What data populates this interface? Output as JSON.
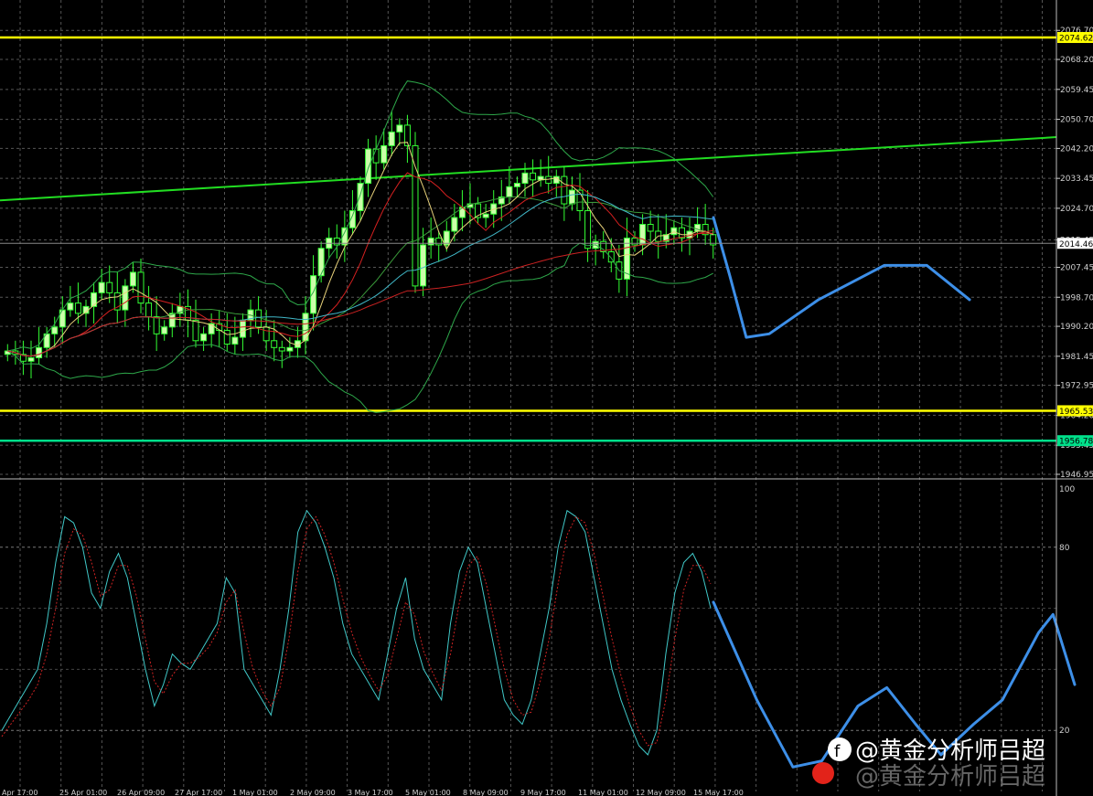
{
  "chart_data": [
    {
      "type": "candlestick",
      "panel": "price",
      "title": "",
      "ylim": [
        1946.95,
        2079.7
      ],
      "yticks": [
        "2076.70",
        "2068.20",
        "2059.45",
        "2050.70",
        "2042.20",
        "2033.45",
        "2024.70",
        "2015.45",
        "2007.45",
        "1998.70",
        "1990.20",
        "1981.45",
        "1972.95",
        "1964.20",
        "1955.45",
        "1946.95"
      ],
      "xticks": [
        "Apr 17:00",
        "25 Apr 01:00",
        "26 Apr 09:00",
        "27 Apr 17:00",
        "1 May 01:00",
        "2 May 09:00",
        "3 May 17:00",
        "5 May 01:00",
        "8 May 09:00",
        "9 May 17:00",
        "11 May 01:00",
        "12 May 09:00",
        "15 May 17:00"
      ],
      "grid": true,
      "current_price": "2014.46",
      "horizontal_levels": [
        {
          "value": 2074.62,
          "label": "2074.62",
          "color": "#ffff00"
        },
        {
          "value": 1965.53,
          "label": "1965.53",
          "color": "#ffff00"
        },
        {
          "value": 1956.78,
          "label": "1956.78",
          "color": "#00e08a"
        }
      ],
      "trendline": {
        "from": [
          0,
          2027.0
        ],
        "to": [
          1,
          2045.5
        ],
        "color": "#22dd22"
      },
      "candle_colors": {
        "up": "#ccffaa",
        "down": "#000000",
        "wick": "#33ff33"
      },
      "candles_close": [
        1983,
        1982,
        1980,
        1981,
        1984,
        1988,
        1990,
        1995,
        1997,
        1994,
        1996,
        2000,
        2003,
        2000,
        1995,
        2002,
        2006,
        1997,
        1993,
        1988,
        1990,
        1994,
        1996,
        1992,
        1986,
        1988,
        1991,
        1989,
        1985,
        1987,
        1992,
        1995,
        1990,
        1986,
        1984,
        1983,
        1984,
        1986,
        1994,
        2005,
        2013,
        2016,
        2014,
        2019,
        2024,
        2032,
        2042,
        2038,
        2043,
        2047,
        2049,
        2043,
        2002,
        2014,
        2016,
        2014,
        2018,
        2022,
        2025,
        2026,
        2022,
        2023,
        2026,
        2028,
        2031,
        2032,
        2035,
        2033,
        2034,
        2032,
        2034,
        2026,
        2030,
        2024,
        2013,
        2015,
        2012,
        2009,
        2004,
        2016,
        2014,
        2020,
        2018,
        2015,
        2017,
        2019,
        2016,
        2018,
        2020,
        2017,
        2014
      ],
      "forecast_path": [
        [
          0,
          2022
        ],
        [
          0.05,
          2005
        ],
        [
          0.1,
          1987
        ],
        [
          0.17,
          1988
        ],
        [
          0.32,
          1998
        ],
        [
          0.52,
          2008
        ],
        [
          0.65,
          2008
        ],
        [
          0.78,
          1998
        ]
      ],
      "overlays": [
        "bollinger-bands",
        "moving-averages"
      ]
    },
    {
      "type": "line",
      "panel": "stochastic-oscillator",
      "ylim": [
        0,
        100
      ],
      "yticks": [
        "100",
        "80",
        "20"
      ],
      "levels": [
        80,
        20
      ],
      "series": [
        {
          "color": "#40c8c8",
          "style": "solid",
          "values": [
            20,
            25,
            30,
            35,
            40,
            55,
            75,
            90,
            88,
            80,
            65,
            60,
            72,
            78,
            70,
            55,
            40,
            28,
            35,
            45,
            42,
            40,
            45,
            50,
            55,
            70,
            65,
            40,
            35,
            30,
            25,
            40,
            60,
            85,
            92,
            88,
            80,
            70,
            55,
            45,
            40,
            35,
            30,
            45,
            60,
            70,
            50,
            40,
            35,
            30,
            55,
            72,
            80,
            75,
            60,
            45,
            30,
            25,
            22,
            30,
            45,
            60,
            80,
            92,
            90,
            85,
            70,
            55,
            40,
            30,
            22,
            15,
            12,
            20,
            45,
            65,
            75,
            78,
            72,
            60
          ]
        },
        {
          "color": "#cc2222",
          "style": "dashed",
          "values": [
            18,
            22,
            26,
            30,
            35,
            45,
            60,
            78,
            86,
            84,
            75,
            64,
            66,
            74,
            74,
            64,
            50,
            36,
            32,
            38,
            42,
            42,
            44,
            47,
            52,
            62,
            66,
            52,
            40,
            33,
            28,
            34,
            50,
            72,
            86,
            90,
            84,
            75,
            63,
            52,
            44,
            38,
            33,
            38,
            50,
            62,
            58,
            46,
            39,
            33,
            45,
            62,
            74,
            77,
            68,
            54,
            40,
            30,
            25,
            26,
            36,
            50,
            68,
            84,
            90,
            88,
            78,
            64,
            50,
            38,
            28,
            20,
            15,
            16,
            30,
            50,
            66,
            74,
            74,
            68
          ]
        }
      ],
      "forecast_path": [
        [
          0,
          62
        ],
        [
          0.12,
          30
        ],
        [
          0.22,
          8
        ],
        [
          0.3,
          10
        ],
        [
          0.4,
          28
        ],
        [
          0.48,
          34
        ],
        [
          0.56,
          22
        ],
        [
          0.63,
          12
        ],
        [
          0.72,
          22
        ],
        [
          0.8,
          30
        ],
        [
          0.9,
          52
        ],
        [
          0.94,
          58
        ],
        [
          1.0,
          35
        ]
      ]
    }
  ],
  "watermark": {
    "handle": "@黄金分析师吕超",
    "site": "微博"
  }
}
